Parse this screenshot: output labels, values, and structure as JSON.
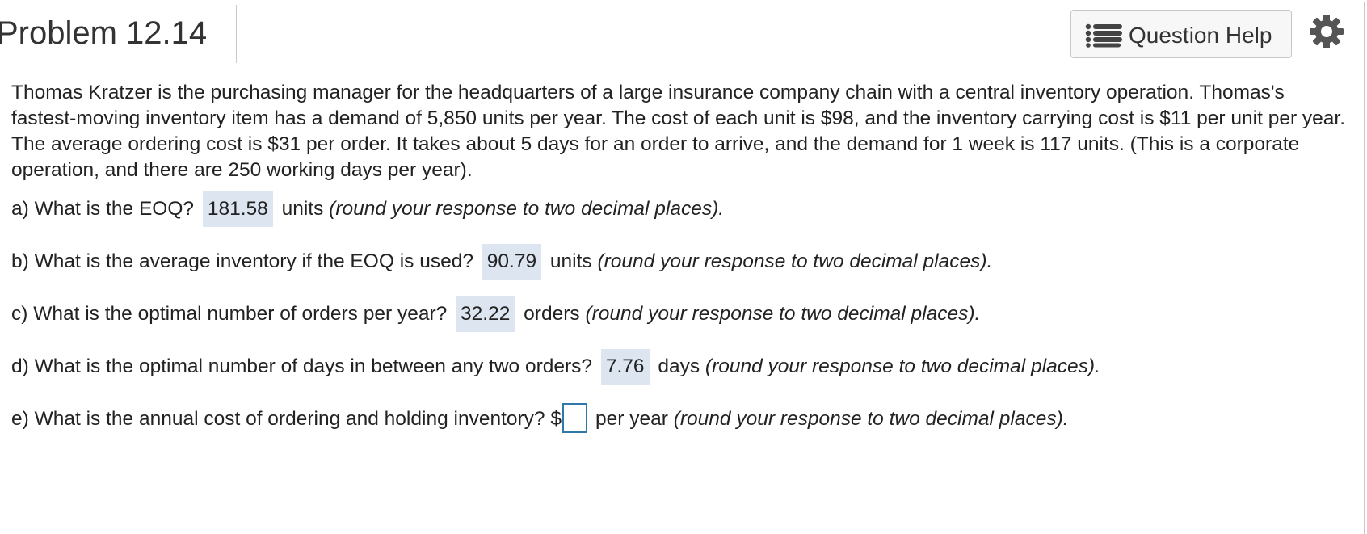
{
  "header": {
    "title": "Problem 12.14",
    "question_help_label": "Question Help",
    "icons": {
      "help": "list-icon",
      "settings": "gear-icon"
    }
  },
  "problem": {
    "intro": "Thomas Kratzer is the purchasing manager for the headquarters of a large insurance company chain with a central inventory operation. Thomas's fastest-moving inventory item has a demand of 5,850 units per year. The cost of each unit is $98, and the inventory carrying cost is $11 per unit per year. The average ordering cost is $31 per order. It takes about 5 days for an order to arrive, and the demand for 1 week is 117 units. (This is a corporate operation, and there are 250 working days per year).",
    "questions": [
      {
        "prompt": "a) What is the EOQ?",
        "answer": "181.58",
        "unit": "units",
        "hint": "(round your response to two decimal places)."
      },
      {
        "prompt": "b) What is the average inventory if the EOQ is used?",
        "answer": "90.79",
        "unit": "units",
        "hint": "(round your response to two decimal places)."
      },
      {
        "prompt": "c) What is the optimal number of orders per year?",
        "answer": "32.22",
        "unit": "orders",
        "hint": "(round your response to two decimal places)."
      },
      {
        "prompt": "d) What is the optimal number of days in between any two orders?",
        "answer": "7.76",
        "unit": "days",
        "hint": "(round your response to two decimal places)."
      },
      {
        "prompt": "e) What is the annual cost of ordering and holding inventory? $",
        "answer": "",
        "unit": "per year",
        "hint": "(round your response to two decimal places)."
      }
    ]
  },
  "colors": {
    "answer_highlight": "#dde5f1",
    "input_border": "#2f78a8",
    "border": "#c9c9c9"
  }
}
